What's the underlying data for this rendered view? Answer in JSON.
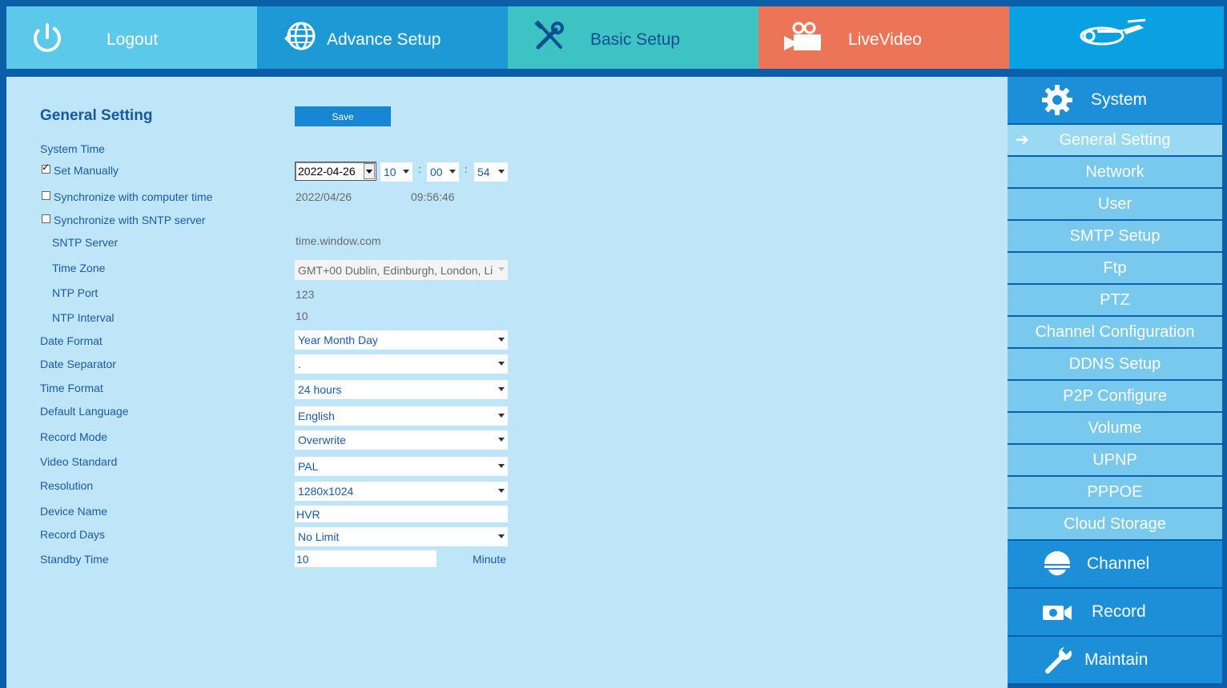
{
  "nav": {
    "logout": "Logout",
    "advance_setup": "Advance Setup",
    "basic_setup": "Basic Setup",
    "live_video": "LiveVideo",
    "logo_icon": "camera-logo-icon"
  },
  "colors": {
    "nav_logout": "#5cc8ea",
    "nav_advance": "#1d9ad6",
    "nav_basic": "#3ec3c5",
    "nav_live": "#ec7557",
    "main_bg": "#bfe5f8",
    "sidebar_blue": "#1d8fd8",
    "sidebar_item": "#79c8ee"
  },
  "form": {
    "title": "General Setting",
    "save_label": "Save",
    "system_time_label": "System Time",
    "set_manually_label": "Set Manually",
    "set_manually_checked": true,
    "date_value": "2022-04-26",
    "hour_value": "10",
    "minute_value": "00",
    "second_value": "54",
    "time_separator": ":",
    "sync_computer_label": "Synchronize with computer time",
    "sync_computer_checked": false,
    "computer_date": "2022/04/26",
    "computer_time": "09:56:46",
    "sync_sntp_label": "Synchronize with SNTP server",
    "sync_sntp_checked": false,
    "sntp_server_label": "SNTP Server",
    "sntp_server_value": "time.window.com",
    "time_zone_label": "Time Zone",
    "time_zone_value": "GMT+00 Dublin, Edinburgh, London, Li",
    "ntp_port_label": "NTP Port",
    "ntp_port_value": "123",
    "ntp_interval_label": "NTP Interval",
    "ntp_interval_value": "10",
    "date_format_label": "Date Format",
    "date_format_value": "Year Month Day",
    "date_separator_label": "Date Separator",
    "date_separator_value": ".",
    "time_format_label": "Time Format",
    "time_format_value": "24 hours",
    "language_label": "Default Language",
    "language_value": "English",
    "record_mode_label": "Record Mode",
    "record_mode_value": "Overwrite",
    "video_standard_label": "Video Standard",
    "video_standard_value": "PAL",
    "resolution_label": "Resolution",
    "resolution_value": "1280x1024",
    "device_name_label": "Device Name",
    "device_name_value": "HVR",
    "record_days_label": "Record Days",
    "record_days_value": "No Limit",
    "standby_label": "Standby Time",
    "standby_value": "10",
    "standby_unit": "Minute"
  },
  "sidebar": {
    "system": "System",
    "items": [
      "General Setting",
      "Network",
      "User",
      "SMTP Setup",
      "Ftp",
      "PTZ",
      "Channel Configuration",
      "DDNS Setup",
      "P2P Configure",
      "Volume",
      "UPNP",
      "PPPOE",
      "Cloud Storage"
    ],
    "active_index": 0,
    "channel": "Channel",
    "record": "Record",
    "maintain": "Maintain"
  }
}
